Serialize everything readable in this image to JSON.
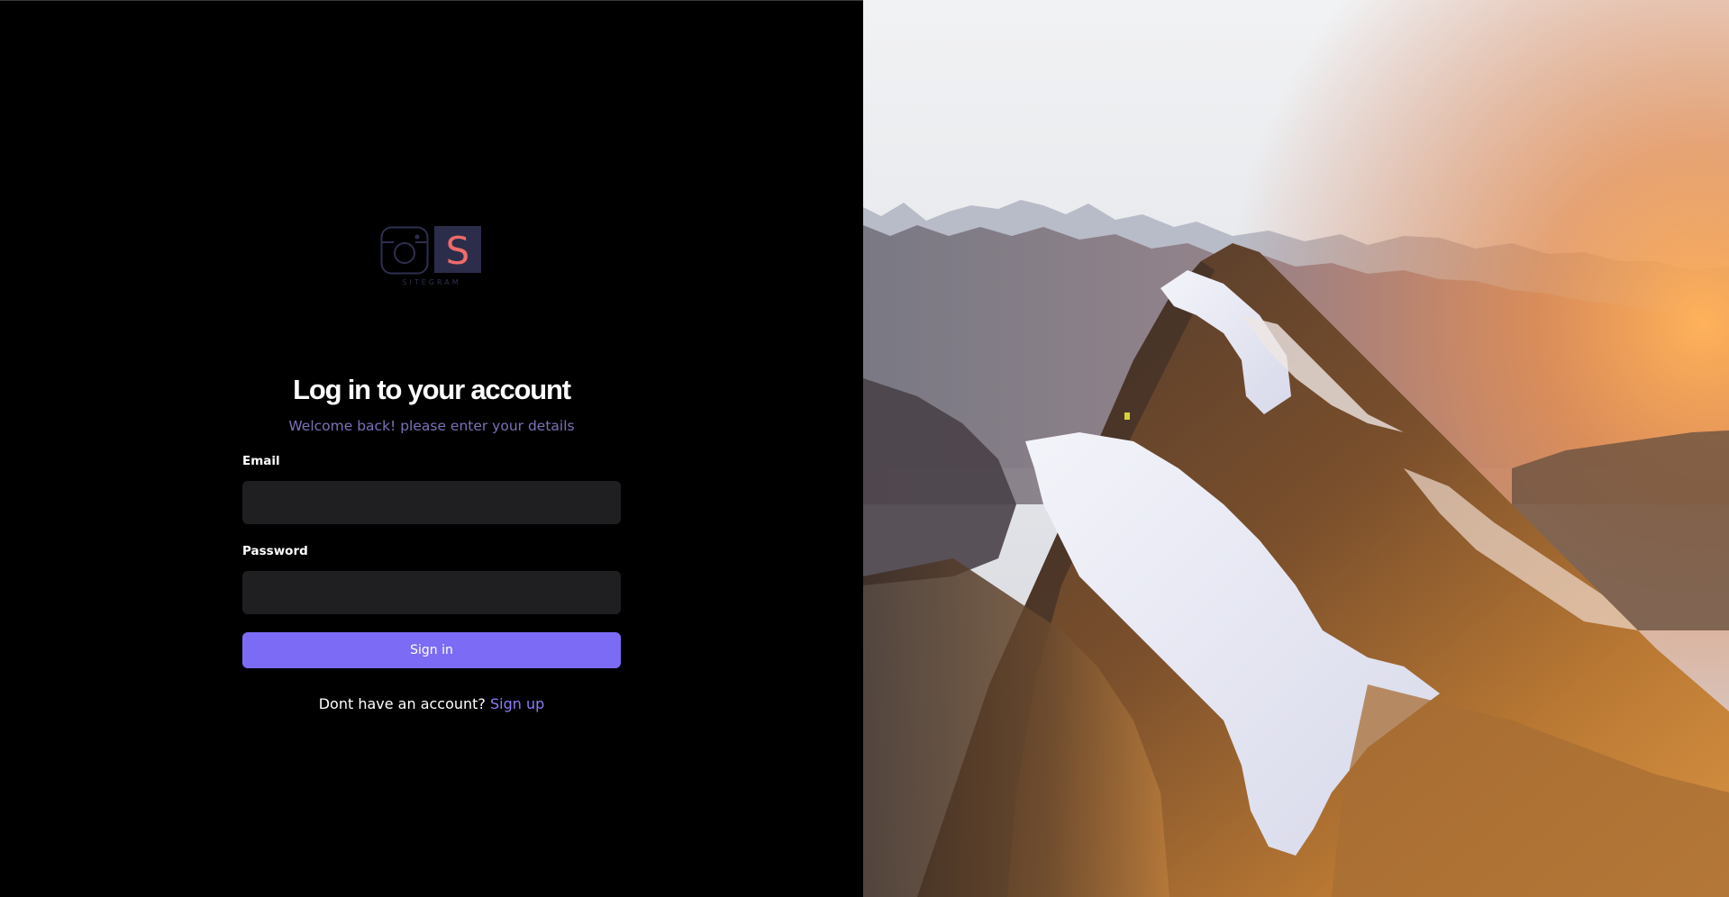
{
  "brand": {
    "logo_letter": "S",
    "logo_text": "SITEGRAM",
    "icon": "camera-icon"
  },
  "auth": {
    "title": "Log in to your account",
    "subtitle": "Welcome back! please enter your details",
    "email_label": "Email",
    "email_value": "",
    "password_label": "Password",
    "password_value": "",
    "submit_label": "Sign in",
    "signup_prompt": "Dont have an account?",
    "signup_link": "Sign up"
  },
  "colors": {
    "background": "#000000",
    "accent": "#7c6cf5",
    "input_bg": "#1f1f22",
    "subtitle": "#7a72b8",
    "logo_box": "#2b2d4a",
    "logo_letter": "#f06a6a"
  }
}
